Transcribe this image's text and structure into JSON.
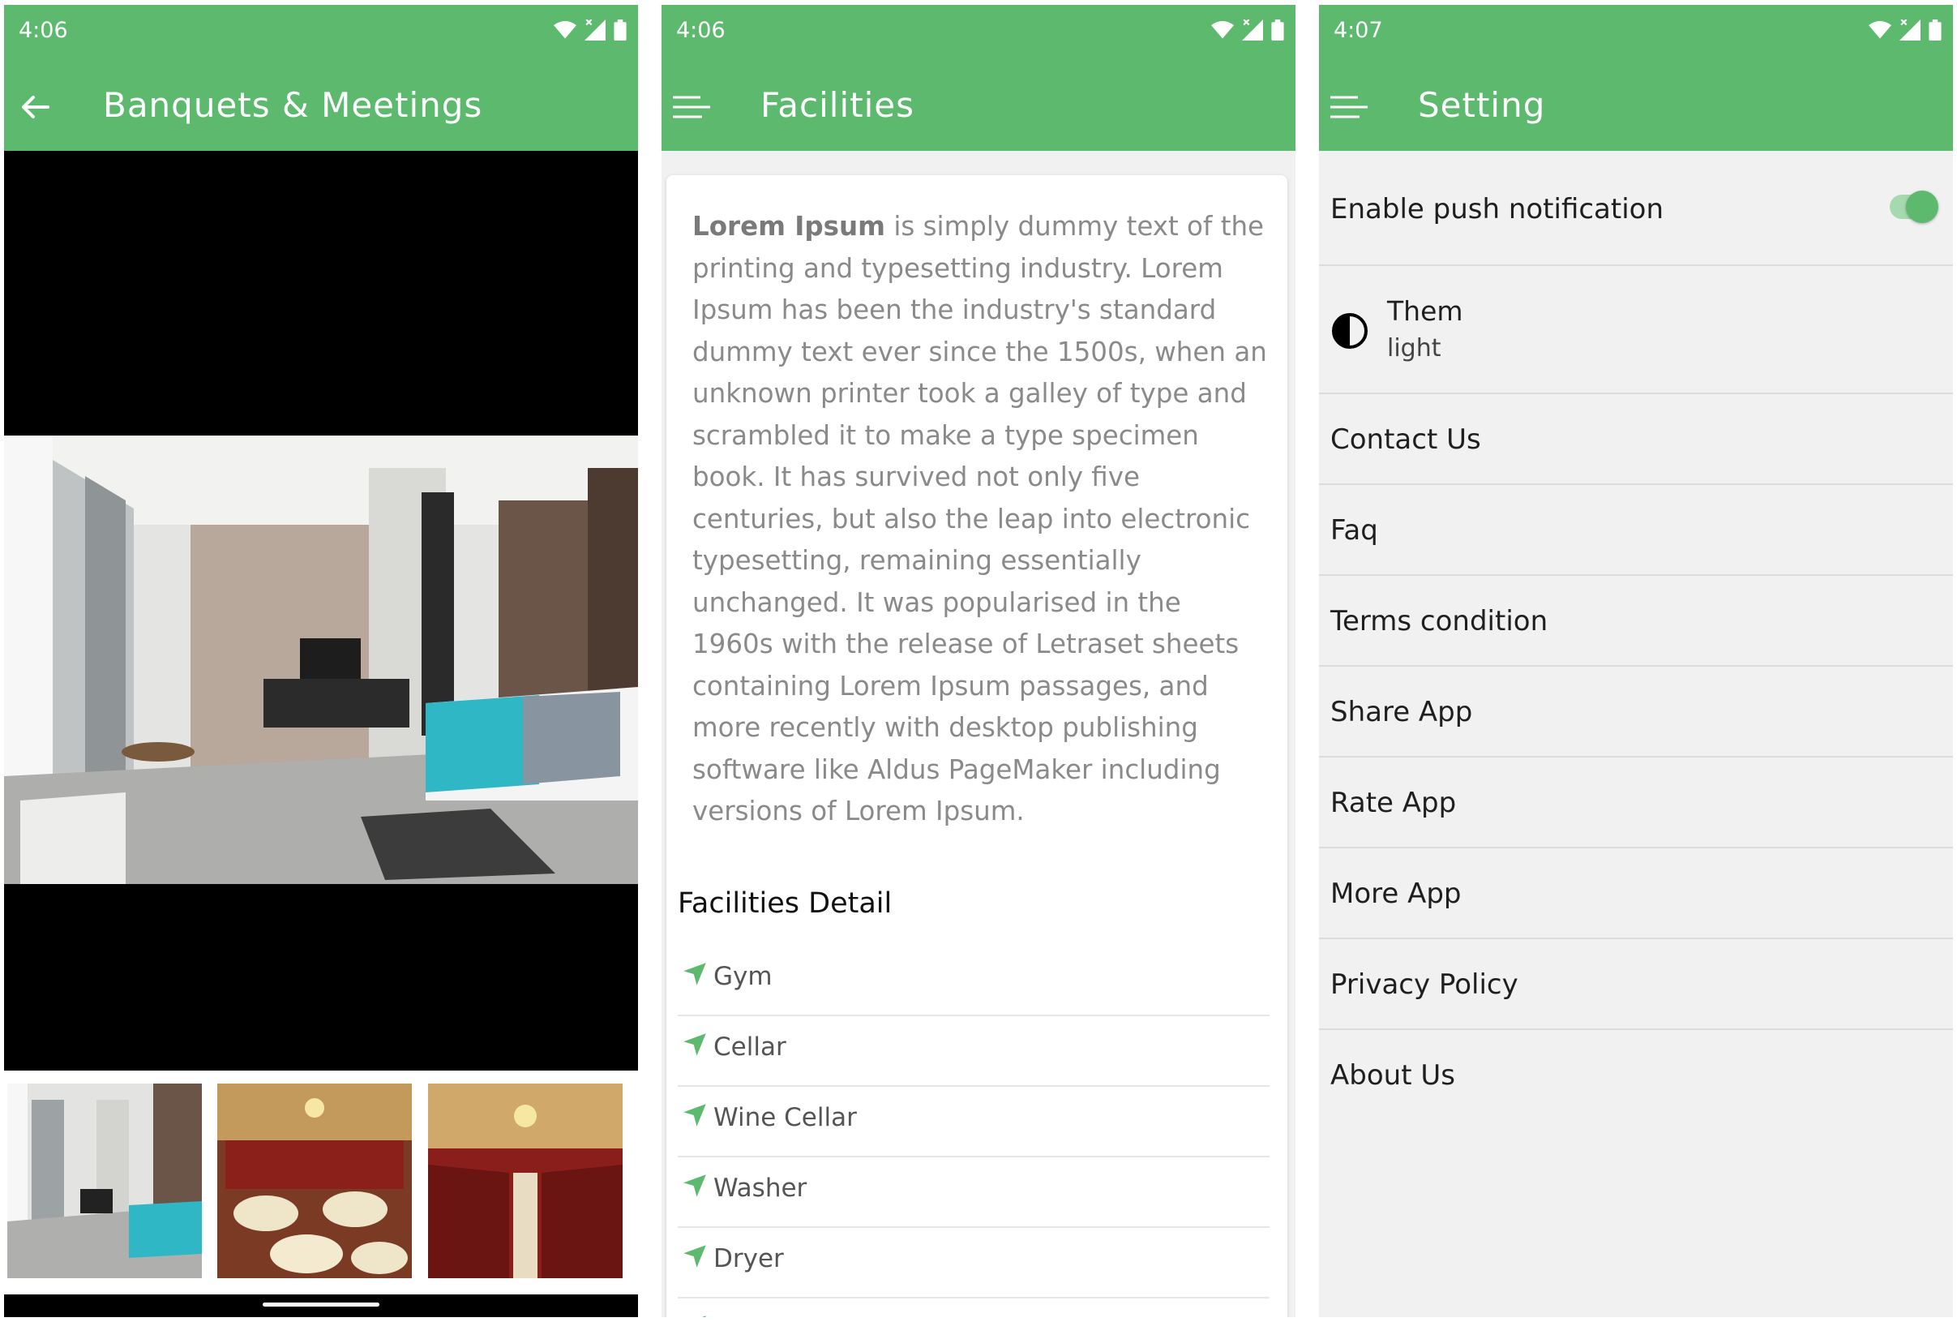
{
  "status_bar": {
    "screen1_time": "4:06",
    "screen2_time": "4:06",
    "screen3_time": "4:07"
  },
  "screen1": {
    "title": "Banquets & Meetings",
    "main_image": "hotel bedroom photo",
    "thumbnails": [
      "bedroom thumbnail",
      "banquet hall round tables thumbnail",
      "banquet hall rows of chairs thumbnail"
    ]
  },
  "screen2": {
    "title": "Facilities",
    "intro_bold": "Lorem Ipsum",
    "intro_text": " is simply dummy text of the printing and typesetting industry. Lorem Ipsum has been the industry's standard dummy text ever since the 1500s, when an unknown printer took a galley of type and scrambled it to make a type specimen book. It has survived not only five centuries, but also the leap into electronic typesetting, remaining essentially unchanged. It was popularised in the 1960s with the release of Letraset sheets containing Lorem Ipsum passages, and more recently with desktop publishing software like Aldus PageMaker including versions of Lorem Ipsum.",
    "detail_title": "Facilities Detail",
    "facilities": [
      "Gym",
      "Cellar",
      "Wine Cellar",
      "Washer",
      "Dryer"
    ]
  },
  "screen3": {
    "title": "Setting",
    "push_label": "Enable push notification",
    "push_enabled": true,
    "theme_label": "Them",
    "theme_value": "light",
    "items": [
      "Contact Us",
      "Faq",
      "Terms condition",
      "Share App",
      "Rate App",
      "More App",
      "Privacy Policy",
      "About Us"
    ]
  },
  "colors": {
    "primary": "#5cb96e",
    "background": "#f1f1f1",
    "text": "#1f1f1f"
  },
  "icons": {
    "back": "arrow-left-icon",
    "menu": "hamburger-menu-icon",
    "facility": "navigation-arrow-icon",
    "theme": "half-circle-contrast-icon",
    "wifi": "wifi-icon",
    "signal": "signal-icon",
    "battery": "battery-icon"
  }
}
